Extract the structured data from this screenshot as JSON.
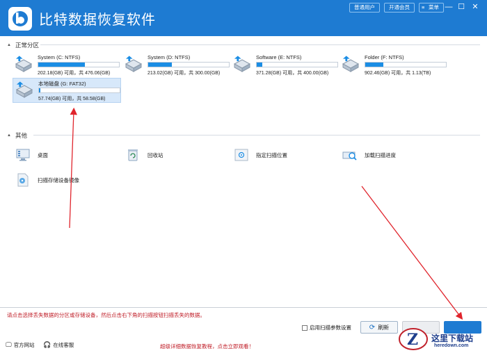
{
  "window": {
    "title": "比特数据恢复软件",
    "buttons": [
      "普通用户",
      "开通会员",
      "菜单"
    ],
    "controls": [
      "—",
      "☐",
      "✕"
    ]
  },
  "sections": {
    "normal": "正常分区",
    "other": "其他"
  },
  "drives": [
    {
      "name": "System (C: NTFS)",
      "info": "202.18(GB) 可用，共 476.06(GB)",
      "usage": 0.58,
      "selected": false
    },
    {
      "name": "System (D: NTFS)",
      "info": "213.02(GB) 可用，共 300.00(GB)",
      "usage": 0.29,
      "selected": false
    },
    {
      "name": "Software (E: NTFS)",
      "info": "371.28(GB) 可用，共 400.00(GB)",
      "usage": 0.07,
      "selected": false
    },
    {
      "name": "Folder (F: NTFS)",
      "info": "902.46(GB) 可用，共 1.13(TB)",
      "usage": 0.22,
      "selected": false
    },
    {
      "name": "本地磁盘 (G: FAT32)",
      "info": "57.74(GB) 可用，共 58.58(GB)",
      "usage": 0.015,
      "selected": true
    }
  ],
  "others": [
    {
      "label": "桌面",
      "icon": "desktop-icon"
    },
    {
      "label": "回收站",
      "icon": "recycle-bin-icon"
    },
    {
      "label": "指定扫描位置",
      "icon": "folder-target-icon"
    },
    {
      "label": "加载扫描进度",
      "icon": "load-progress-icon"
    },
    {
      "label": "扫描存储设备镜像",
      "icon": "disk-image-icon"
    }
  ],
  "bottom": {
    "hint": "请点击选择丢失数据的分区或存储设备，然后点击右下角的扫描按钮扫描丢失的数据。",
    "checkbox_label": "启用扫描参数设置",
    "refresh": "刷新"
  },
  "footer": {
    "website": "官方网站",
    "service": "在线客服",
    "promo": "超级详细数据恢复教程，点击立即观看！"
  },
  "watermark": {
    "text": "这里下载站",
    "url": "heredown.com"
  },
  "colors": {
    "accent": "#1e7bd2",
    "bar": "#1b8de4",
    "warning": "#c0202a"
  }
}
